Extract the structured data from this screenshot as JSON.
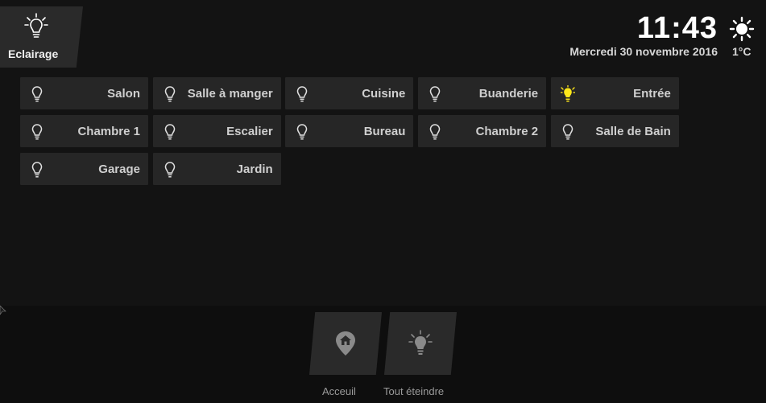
{
  "section": {
    "label": "Eclairage"
  },
  "header": {
    "time": "11:43",
    "date": "Mercredi 30 novembre 2016",
    "temperature": "1°C"
  },
  "rooms": [
    {
      "label": "Salon",
      "on": false
    },
    {
      "label": "Salle à manger",
      "on": false
    },
    {
      "label": "Cuisine",
      "on": false
    },
    {
      "label": "Buanderie",
      "on": false
    },
    {
      "label": "Entrée",
      "on": true
    },
    {
      "label": "Chambre 1",
      "on": false
    },
    {
      "label": "Escalier",
      "on": false
    },
    {
      "label": "Bureau",
      "on": false
    },
    {
      "label": "Chambre 2",
      "on": false
    },
    {
      "label": "Salle de Bain",
      "on": false
    },
    {
      "label": "Garage",
      "on": false
    },
    {
      "label": "Jardin",
      "on": false
    }
  ],
  "dock": {
    "home_label": "Acceuil",
    "all_off_label": "Tout éteindre"
  },
  "colors": {
    "bulb_on": "#ffe81a",
    "bulb_off": "#e0e0e0",
    "dock_icon": "#8a8a8a"
  }
}
